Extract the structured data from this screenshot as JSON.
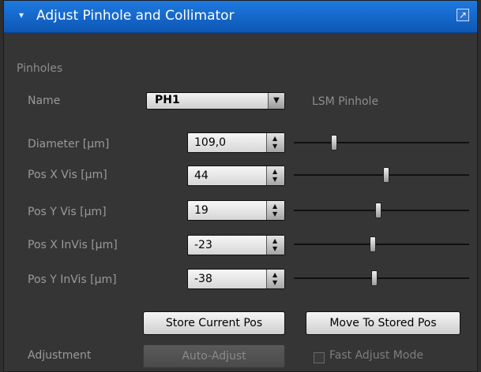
{
  "panel": {
    "title": "Adjust Pinhole and Collimator",
    "section_title": "Pinholes"
  },
  "name_row": {
    "label": "Name",
    "selected": "PH1",
    "hint": "LSM Pinhole"
  },
  "fields": [
    {
      "label": "Diameter [µm]",
      "value": "109,0",
      "slider_fraction": 0.22
    },
    {
      "label": "Pos X Vis [µm]",
      "value": "44",
      "slider_fraction": 0.53
    },
    {
      "label": "Pos Y Vis [µm]",
      "value": "19",
      "slider_fraction": 0.48
    },
    {
      "label": "Pos X InVis [µm]",
      "value": "-23",
      "slider_fraction": 0.45
    },
    {
      "label": "Pos Y InVis [µm]",
      "value": "-38",
      "slider_fraction": 0.46
    }
  ],
  "buttons": {
    "store": "Store Current Pos",
    "move": "Move To Stored Pos"
  },
  "adjustment": {
    "label": "Adjustment",
    "auto_adjust": "Auto-Adjust",
    "fast_mode": "Fast Adjust Mode"
  }
}
